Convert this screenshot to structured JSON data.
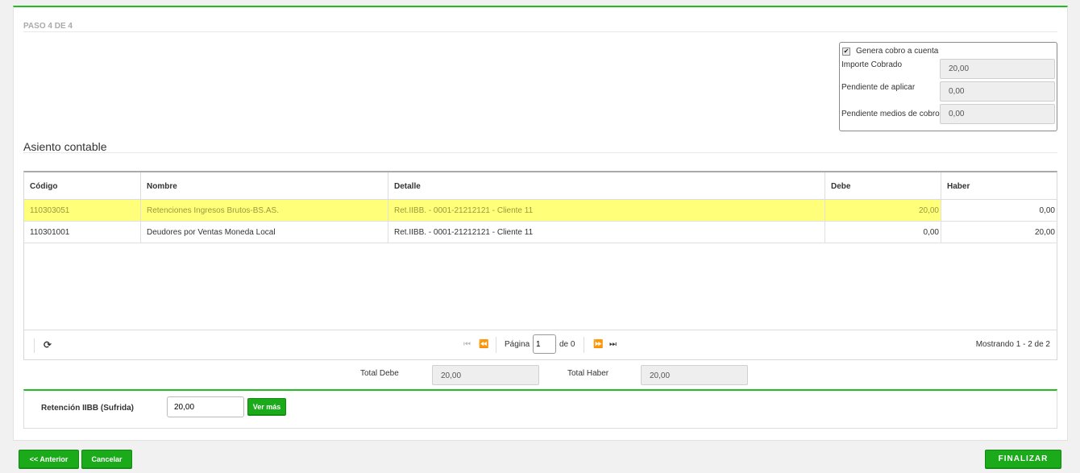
{
  "step_title": "PASO 4 DE 4",
  "cobro": {
    "checkbox_label": "Genera cobro a cuenta",
    "checked": true,
    "fields": [
      {
        "label": "Importe Cobrado",
        "value": "20,00"
      },
      {
        "label": "Pendiente de aplicar",
        "value": "0,00"
      },
      {
        "label": "Pendiente medios de cobro",
        "value": "0,00"
      }
    ]
  },
  "asiento": {
    "title": "Asiento contable",
    "columns": {
      "codigo": "Código",
      "nombre": "Nombre",
      "detalle": "Detalle",
      "debe": "Debe",
      "haber": "Haber"
    },
    "rows": [
      {
        "codigo": "110303051",
        "nombre": "Retenciones Ingresos Brutos-BS.AS.",
        "detalle": "Ret.IIBB. - 0001-21212121 - Cliente 11",
        "debe": "20,00",
        "haber": "0,00"
      },
      {
        "codigo": "110301001",
        "nombre": "Deudores por Ventas Moneda Local",
        "detalle": "Ret.IIBB. - 0001-21212121 - Cliente 11",
        "debe": "0,00",
        "haber": "20,00"
      }
    ],
    "pager": {
      "page_label": "Página",
      "page_value": "1",
      "of_label": "de 0",
      "count_text": "Mostrando 1 - 2 de 2"
    }
  },
  "totals": {
    "debe_label": "Total Debe",
    "debe_value": "20,00",
    "haber_label": "Total Haber",
    "haber_value": "20,00"
  },
  "retencion": {
    "label": "Retención IIBB (Sufrida)",
    "value": "20,00",
    "button": "Ver más"
  },
  "footer": {
    "anterior": "<< Anterior",
    "cancelar": "Cancelar",
    "finalizar": "FINALIZAR"
  },
  "colors": {
    "accent": "#1aaa1a",
    "selected_row": "#ffff7a"
  }
}
